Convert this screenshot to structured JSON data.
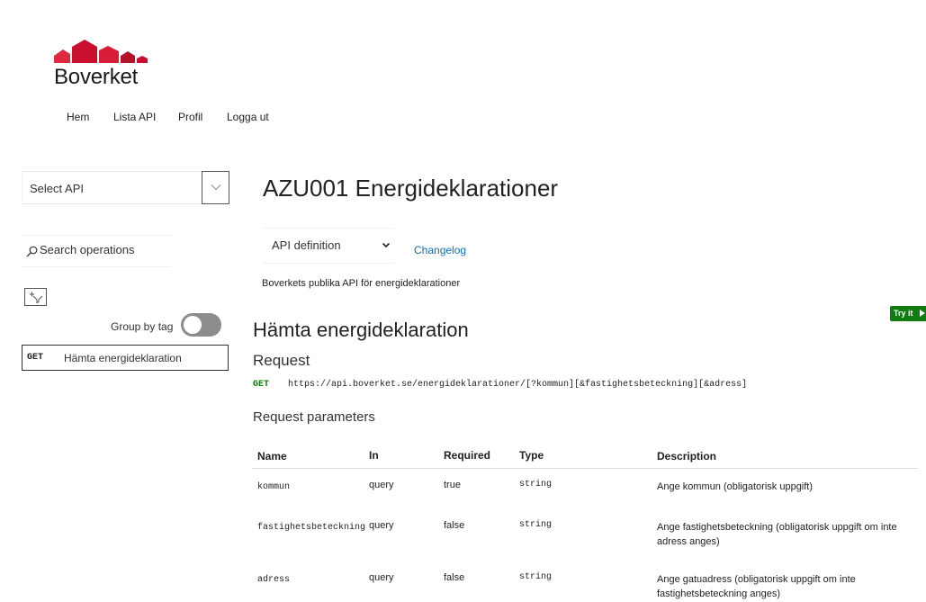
{
  "brand": {
    "name": "Boverket",
    "logo_colors": [
      "#c8102e",
      "#e0283e",
      "#b3142b"
    ]
  },
  "nav": {
    "items": [
      "Hem",
      "Lista API",
      "Profil",
      "Logga ut"
    ]
  },
  "sidebar": {
    "select_api_label": "Select API",
    "search_placeholder": "Search operations",
    "group_by_tag_label": "Group by tag",
    "group_by_tag_on": false,
    "operations": [
      {
        "method": "GET",
        "name": "Hämta energideklaration"
      }
    ]
  },
  "api": {
    "title": "AZU001 Energideklarationer",
    "definition_select": "API definition",
    "changelog_label": "Changelog",
    "description": "Boverkets publika API för energideklarationer"
  },
  "try_it": {
    "label": "Try it"
  },
  "operation": {
    "title": "Hämta energideklaration",
    "request_heading": "Request",
    "method": "GET",
    "url": "https://api.boverket.se/energideklarationer/[?kommun][&fastighetsbeteckning][&adress]",
    "params_heading": "Request parameters",
    "columns": [
      "Name",
      "In",
      "Required",
      "Type",
      "Description"
    ],
    "params": [
      {
        "name": "kommun",
        "in": "query",
        "required": "true",
        "type": "string",
        "description": "Ange kommun (obligatorisk uppgift)"
      },
      {
        "name": "fastighetsbeteckning",
        "in": "query",
        "required": "false",
        "type": "string",
        "description": "Ange fastighetsbeteckning (obligatorisk uppgift om inte adress anges)"
      },
      {
        "name": "adress",
        "in": "query",
        "required": "false",
        "type": "string",
        "description": "Ange gatuadress (obligatorisk uppgift om inte fastighetsbeteckning anges)"
      }
    ]
  },
  "colors": {
    "accent_green": "#107c10",
    "link_blue": "#0b6fb8",
    "toggle_off": "#8c8c8c"
  }
}
